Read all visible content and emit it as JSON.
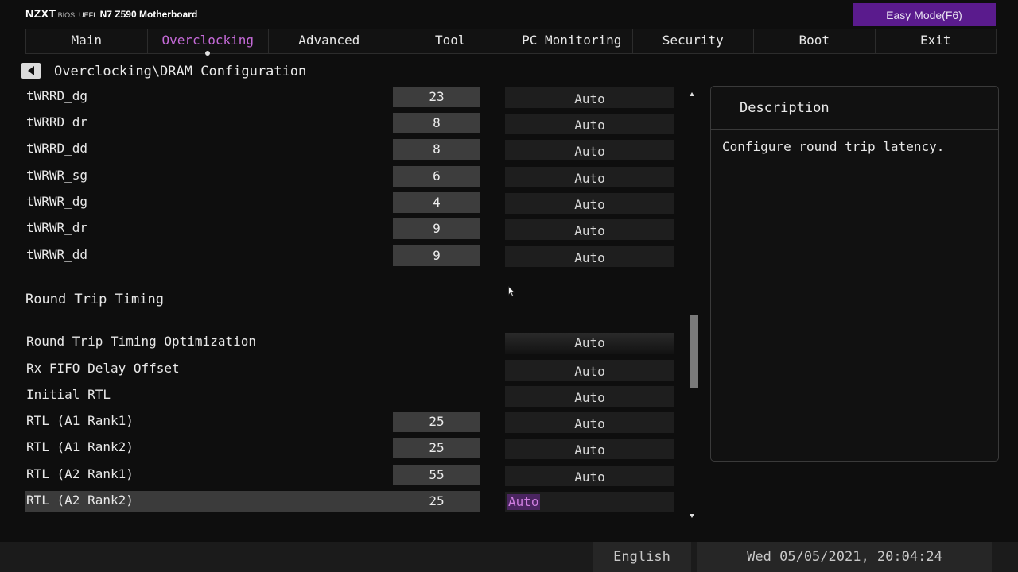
{
  "brand": {
    "logo": "NZXT",
    "bios": "BIOS",
    "uefi": "UEFI",
    "model": "N7 Z590 Motherboard"
  },
  "easy_mode_label": "Easy Mode(F6)",
  "tabs": [
    {
      "label": "Main",
      "active": false
    },
    {
      "label": "Overclocking",
      "active": true
    },
    {
      "label": "Advanced",
      "active": false
    },
    {
      "label": "Tool",
      "active": false
    },
    {
      "label": "PC Monitoring",
      "active": false
    },
    {
      "label": "Security",
      "active": false
    },
    {
      "label": "Boot",
      "active": false
    },
    {
      "label": "Exit",
      "active": false
    }
  ],
  "breadcrumb": "Overclocking\\DRAM Configuration",
  "rows": [
    {
      "label": "tWRRD_dg",
      "value": "23",
      "option": "Auto"
    },
    {
      "label": "tWRRD_dr",
      "value": "8",
      "option": "Auto"
    },
    {
      "label": "tWRRD_dd",
      "value": "8",
      "option": "Auto"
    },
    {
      "label": "tWRWR_sg",
      "value": "6",
      "option": "Auto"
    },
    {
      "label": "tWRWR_dg",
      "value": "4",
      "option": "Auto"
    },
    {
      "label": "tWRWR_dr",
      "value": "9",
      "option": "Auto"
    },
    {
      "label": "tWRWR_dd",
      "value": "9",
      "option": "Auto"
    }
  ],
  "section_title": "Round Trip Timing",
  "rtt_rows": [
    {
      "label": "Round Trip Timing Optimization",
      "option": "Auto"
    },
    {
      "label": "Rx FIFO Delay Offset",
      "option": "Auto"
    },
    {
      "label": "Initial RTL",
      "option": "Auto"
    },
    {
      "label": "RTL (A1 Rank1)",
      "value": "25",
      "option": "Auto"
    },
    {
      "label": "RTL (A1 Rank2)",
      "value": "25",
      "option": "Auto"
    },
    {
      "label": "RTL (A2 Rank1)",
      "value": "55",
      "option": "Auto"
    },
    {
      "label": "RTL (A2 Rank2)",
      "value": "25",
      "option": "Auto",
      "selected": true
    }
  ],
  "description": {
    "title": "Description",
    "text": "Configure round trip latency."
  },
  "footer": {
    "language": "English",
    "datetime": "Wed 05/05/2021, 20:04:24"
  },
  "colors": {
    "accent": "#c56ad8",
    "easy_mode_bg": "#5a1b8d",
    "background": "#0e0e0e"
  }
}
